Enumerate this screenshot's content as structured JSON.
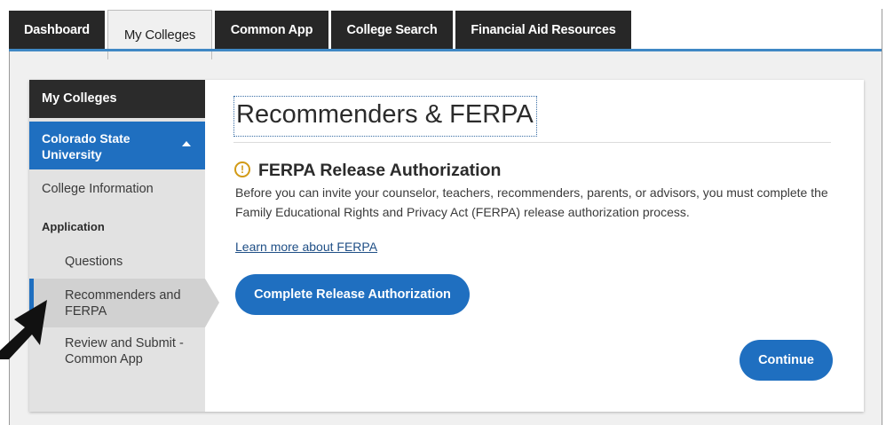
{
  "tabs": [
    {
      "label": "Dashboard"
    },
    {
      "label": "My Colleges"
    },
    {
      "label": "Common App"
    },
    {
      "label": "College Search"
    },
    {
      "label": "Financial Aid Resources"
    }
  ],
  "sidebar": {
    "header": "My Colleges",
    "college": "Colorado State University",
    "college_line1": "Colorado State",
    "college_line2": "University",
    "college_info": "College Information",
    "section_label": "Application",
    "items": [
      {
        "label": "Questions"
      },
      {
        "label_line1": "Recommenders and",
        "label_line2": "FERPA"
      },
      {
        "label_line1": "Review and Submit -",
        "label_line2": "Common App"
      }
    ]
  },
  "main": {
    "title": "Recommenders & FERPA",
    "ferpa_heading": "FERPA Release Authorization",
    "ferpa_icon": "!",
    "ferpa_text": "Before you can invite your counselor, teachers, recommenders, parents, or advisors, you must complete the Family Educational Rights and Privacy Act (FERPA) release authorization process.",
    "learn_more": "Learn more about FERPA",
    "auth_button": "Complete Release Authorization",
    "continue_button": "Continue"
  },
  "colors": {
    "accent": "#1f6fc0",
    "tab_dark": "#272727",
    "warning": "#d29a16"
  }
}
